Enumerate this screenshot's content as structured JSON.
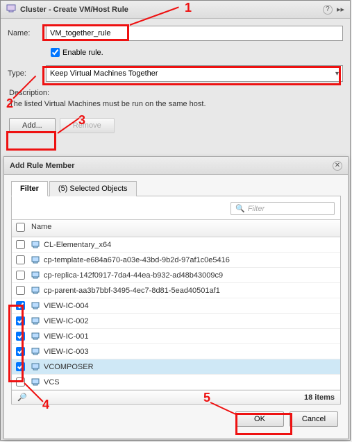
{
  "dialog": {
    "title": "Cluster - Create VM/Host Rule",
    "nameLabel": "Name:",
    "nameValue": "VM_together_rule",
    "enableLabel": "Enable rule.",
    "enableChecked": true,
    "typeLabel": "Type:",
    "typeValue": "Keep Virtual Machines Together",
    "descLabel": "Description:",
    "descText": "The listed Virtual Machines must be run on the same host.",
    "addLabel": "Add...",
    "removeLabel": "Remove"
  },
  "modal": {
    "title": "Add Rule Member",
    "tabs": {
      "filter": "Filter",
      "selected": "(5) Selected Objects"
    },
    "filterPlaceholder": "Filter",
    "gridHeader": "Name",
    "items": [
      {
        "name": "CL-Elementary_x64",
        "checked": false,
        "selected": false
      },
      {
        "name": "cp-template-e684a670-a03e-43bd-9b2d-97af1c0e5416",
        "checked": false,
        "selected": false
      },
      {
        "name": "cp-replica-142f0917-7da4-44ea-b932-ad48b43009c9",
        "checked": false,
        "selected": false
      },
      {
        "name": "cp-parent-aa3b7bbf-3495-4ec7-8d81-5ead40501af1",
        "checked": false,
        "selected": false
      },
      {
        "name": "VIEW-IC-004",
        "checked": true,
        "selected": false
      },
      {
        "name": "VIEW-IC-002",
        "checked": true,
        "selected": false
      },
      {
        "name": "VIEW-IC-001",
        "checked": true,
        "selected": false
      },
      {
        "name": "VIEW-IC-003",
        "checked": true,
        "selected": false
      },
      {
        "name": "VCOMPOSER",
        "checked": true,
        "selected": true
      },
      {
        "name": "VCS",
        "checked": false,
        "selected": false
      }
    ],
    "itemCount": "18 items",
    "okLabel": "OK",
    "cancelLabel": "Cancel"
  },
  "annotations": {
    "n1": "1",
    "n2": "2",
    "n3": "3",
    "n4": "4",
    "n5": "5"
  }
}
